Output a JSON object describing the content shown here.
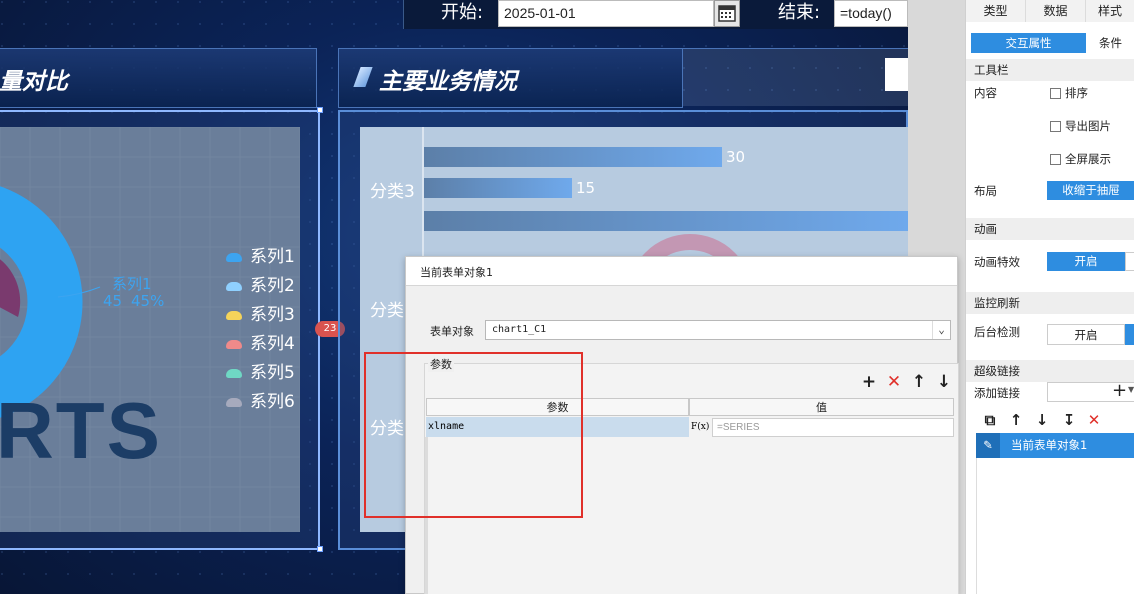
{
  "filter": {
    "start_label": "开始:",
    "start_value": "2025-01-01",
    "end_label": "结束:",
    "end_value": "=today()"
  },
  "left_panel": {
    "title": "量对比",
    "badge_count": "23",
    "pie_label_series": "系列1",
    "pie_label_value": "45",
    "pie_label_percent": "45%",
    "watermark": "RTS",
    "legend": [
      {
        "label": "系列1",
        "color": "#3da4f0"
      },
      {
        "label": "系列2",
        "color": "#8fd0ff"
      },
      {
        "label": "系列3",
        "color": "#f5d45a"
      },
      {
        "label": "系列4",
        "color": "#ef8a8a"
      },
      {
        "label": "系列5",
        "color": "#6fd8c4"
      },
      {
        "label": "系列6",
        "color": "#a6aabd"
      }
    ]
  },
  "right_panel": {
    "title": "主要业务情况",
    "categories": [
      "分类3",
      "分类",
      "分类"
    ],
    "bar_values": [
      "30",
      "15",
      ""
    ]
  },
  "dialog": {
    "title": "当前表单对象1",
    "form_object_label": "表单对象",
    "form_object_value": "chart1_C1",
    "params_section": "参数",
    "col_param": "参数",
    "col_value": "值",
    "rows": [
      {
        "param": "xlname",
        "fx": "F(x)",
        "value": "=SERIES"
      }
    ]
  },
  "props": {
    "tabs": [
      "类型",
      "数据",
      "样式"
    ],
    "subtabs": [
      "交互属性",
      "条件"
    ],
    "toolbar_section": "工具栏",
    "content_label": "内容",
    "checks": [
      "排序",
      "导出图片",
      "全屏展示"
    ],
    "layout_label": "布局",
    "layout_value": "收缩于抽屉",
    "animation_section": "动画",
    "animation_effect_label": "动画特效",
    "animation_on": "开启",
    "monitor_section": "监控刷新",
    "backend_label": "后台检测",
    "backend_on": "开启",
    "hyperlink_section": "超级链接",
    "add_link_label": "添加链接",
    "link_item": "当前表单对象1"
  }
}
